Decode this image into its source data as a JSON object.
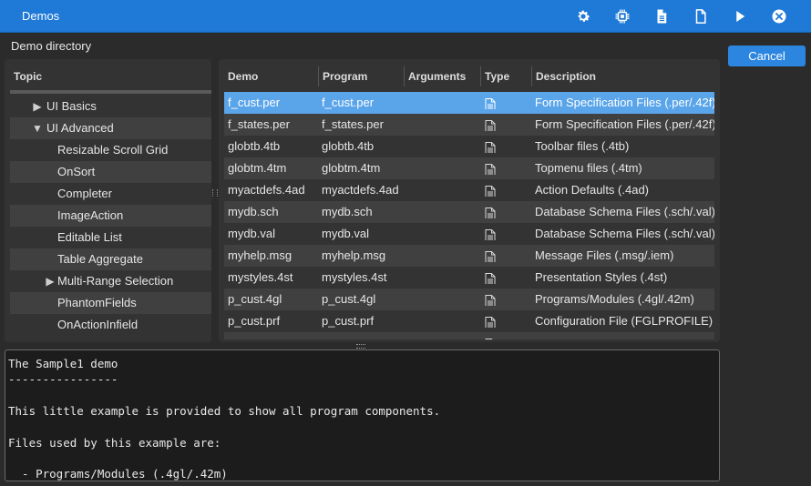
{
  "window": {
    "title": "Demos"
  },
  "toolbar": {
    "icons": [
      "gear-icon",
      "chip-icon",
      "document-icon",
      "blank-document-icon",
      "play-icon",
      "close-circle-icon"
    ]
  },
  "section_label": "Demo directory",
  "cancel_label": "Cancel",
  "tree": {
    "header": "Topic",
    "items": [
      {
        "label": "UI Basics",
        "expander": "▶",
        "level": 1
      },
      {
        "label": "UI Advanced",
        "expander": "▼",
        "level": 1
      },
      {
        "label": "Resizable Scroll Grid",
        "expander": "",
        "level": 2
      },
      {
        "label": "OnSort",
        "expander": "",
        "level": 2
      },
      {
        "label": "Completer",
        "expander": "",
        "level": 2
      },
      {
        "label": "ImageAction",
        "expander": "",
        "level": 2
      },
      {
        "label": "Editable List",
        "expander": "",
        "level": 2
      },
      {
        "label": "Table Aggregate",
        "expander": "",
        "level": 2
      },
      {
        "label": "Multi-Range Selection",
        "expander": "▶",
        "level": 2
      },
      {
        "label": "PhantomFields",
        "expander": "",
        "level": 2
      },
      {
        "label": "OnActionInfield",
        "expander": "",
        "level": 2
      }
    ]
  },
  "table": {
    "columns": [
      "Demo",
      "Program",
      "Arguments",
      "Type",
      "Description"
    ],
    "rows": [
      {
        "demo": "f_cust.per",
        "program": "f_cust.per",
        "args": "",
        "type": "document-icon",
        "desc": "Form Specification Files (.per/.42f)"
      },
      {
        "demo": "f_states.per",
        "program": "f_states.per",
        "args": "",
        "type": "document-icon",
        "desc": "Form Specification Files (.per/.42f)"
      },
      {
        "demo": "globtb.4tb",
        "program": "globtb.4tb",
        "args": "",
        "type": "document-icon",
        "desc": "Toolbar files (.4tb)"
      },
      {
        "demo": "globtm.4tm",
        "program": "globtm.4tm",
        "args": "",
        "type": "document-icon",
        "desc": "Topmenu files (.4tm)"
      },
      {
        "demo": "myactdefs.4ad",
        "program": "myactdefs.4ad",
        "args": "",
        "type": "document-icon",
        "desc": "Action Defaults (.4ad)"
      },
      {
        "demo": "mydb.sch",
        "program": "mydb.sch",
        "args": "",
        "type": "document-icon",
        "desc": "Database Schema Files (.sch/.val)"
      },
      {
        "demo": "mydb.val",
        "program": "mydb.val",
        "args": "",
        "type": "document-icon",
        "desc": "Database Schema Files (.sch/.val)"
      },
      {
        "demo": "myhelp.msg",
        "program": "myhelp.msg",
        "args": "",
        "type": "document-icon",
        "desc": "Message Files (.msg/.iem)"
      },
      {
        "demo": "mystyles.4st",
        "program": "mystyles.4st",
        "args": "",
        "type": "document-icon",
        "desc": "Presentation Styles (.4st)"
      },
      {
        "demo": "p_cust.4gl",
        "program": "p_cust.4gl",
        "args": "",
        "type": "document-icon",
        "desc": "Programs/Modules (.4gl/.42m)"
      },
      {
        "demo": "p_cust.prf",
        "program": "p_cust.prf",
        "args": "",
        "type": "document-icon",
        "desc": "Configuration File (FGLPROFILE)"
      },
      {
        "demo": "",
        "program": "",
        "args": "",
        "type": "document-icon",
        "desc": ""
      }
    ]
  },
  "description_text": {
    "lines": [
      "The Sample1 demo",
      "----------------",
      "",
      "This little example is provided to show all program components.",
      "",
      "Files used by this example are:",
      "",
      "  - Programs/Modules (.4gl/.42m)"
    ]
  },
  "colors": {
    "titlebar": "#1f79d7",
    "selection": "#5aa5ea",
    "accent_button": "#2c86e0"
  }
}
